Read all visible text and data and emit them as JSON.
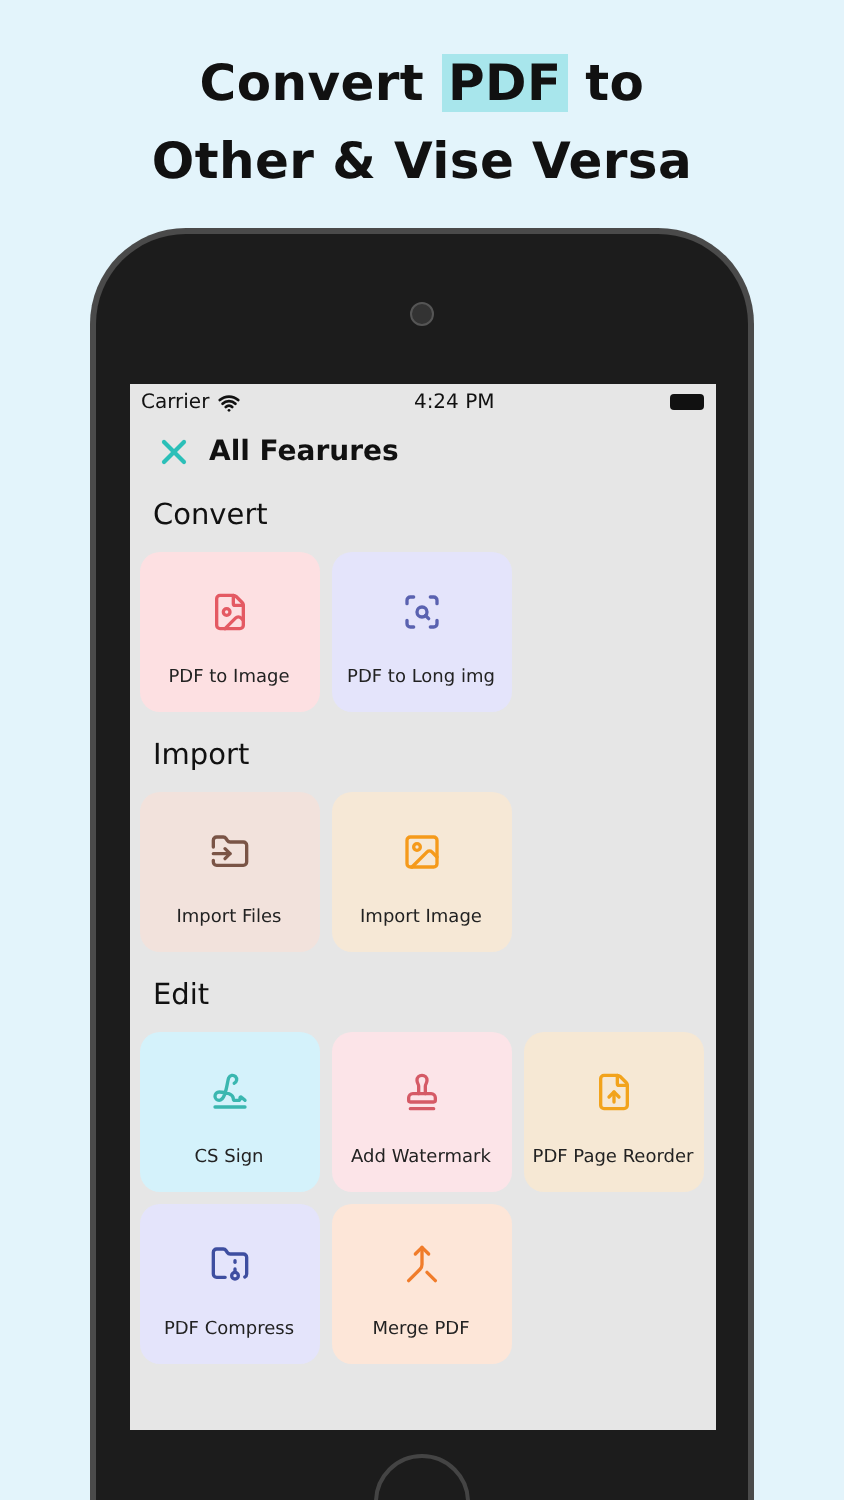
{
  "headline": {
    "line1_before": "Convert",
    "line1_highlight": "PDF",
    "line1_after": "to",
    "line2": "Other & Vise Versa"
  },
  "status_bar": {
    "carrier": "Carrier",
    "time": "4:24 PM"
  },
  "header": {
    "title": "All Fearures"
  },
  "sections": [
    {
      "title": "Convert",
      "items": [
        {
          "label": "PDF to Image",
          "color": "#fde0e2"
        },
        {
          "label": "PDF to Long img",
          "color": "#e4e4fb"
        }
      ]
    },
    {
      "title": "Import",
      "items": [
        {
          "label": "Import Files",
          "color": "#f2e2dc"
        },
        {
          "label": "Import Image",
          "color": "#f6e8d6"
        }
      ]
    },
    {
      "title": "Edit",
      "items": [
        {
          "label": "CS Sign",
          "color": "#d4f2fb"
        },
        {
          "label": "Add Watermark",
          "color": "#fce4e8"
        },
        {
          "label": "PDF Page Reorder",
          "color": "#f6e8d4"
        },
        {
          "label": "PDF Compress",
          "color": "#e4e4fb"
        },
        {
          "label": "Merge PDF",
          "color": "#fde6d8"
        }
      ]
    }
  ]
}
